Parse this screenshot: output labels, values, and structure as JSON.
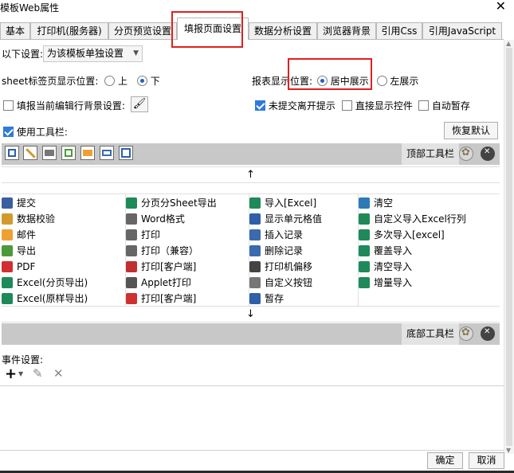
{
  "window": {
    "title": "模板Web属性",
    "close_glyph": "✕"
  },
  "tabs": [
    {
      "label": "基本"
    },
    {
      "label": "打印机(服务器)"
    },
    {
      "label": "分页预览设置"
    },
    {
      "label": "填报页面设置",
      "active": true
    },
    {
      "label": "数据分析设置"
    },
    {
      "label": "浏览器背景"
    },
    {
      "label": "引用Css"
    },
    {
      "label": "引用JavaScript"
    }
  ],
  "settings": {
    "mode_label": "以下设置:",
    "mode_value": "为该模板单独设置",
    "sheet_tab_label": "sheet标签页显示位置:",
    "sheet_tab_top": "上",
    "sheet_tab_bottom": "下",
    "report_pos_label": "报表显示位置:",
    "report_pos_center": "居中展示",
    "report_pos_left": "左展示",
    "fill_bg_label": "填报当前编辑行背景设置:",
    "unsubmitted_label": "未提交离开提示",
    "direct_show_label": "直接显示控件",
    "autosave_label": "自动暂存",
    "use_toolbar_label": "使用工具栏:",
    "restore_default": "恢复默认"
  },
  "top_toolbar": {
    "label": "顶部工具栏"
  },
  "bottom_toolbar": {
    "label": "底部工具栏"
  },
  "arrows": {
    "up": "↑",
    "down": "↓"
  },
  "buttons_grid": [
    [
      {
        "label": "提交",
        "icon": "save-icon",
        "color": "#3a5fa0"
      },
      {
        "label": "分页分Sheet导出",
        "icon": "excel-icon",
        "color": "#1e8a5a"
      },
      {
        "label": "导入[Excel]",
        "icon": "excel-icon",
        "color": "#1e8a5a"
      },
      {
        "label": "清空",
        "icon": "eraser-icon",
        "color": "#2e7ab8"
      }
    ],
    [
      {
        "label": "数据校验",
        "icon": "pencil-icon",
        "color": "#d29a2e"
      },
      {
        "label": "Word格式",
        "icon": "word-icon",
        "color": "#666666"
      },
      {
        "label": "显示单元格值",
        "icon": "cell-icon",
        "color": "#2e5fa8"
      },
      {
        "label": "自定义导入Excel行列",
        "icon": "excel-icon",
        "color": "#1e8a5a"
      }
    ],
    [
      {
        "label": "邮件",
        "icon": "mail-icon",
        "color": "#f0a030"
      },
      {
        "label": "打印",
        "icon": "print-icon",
        "color": "#666666"
      },
      {
        "label": "插入记录",
        "icon": "insert-row-icon",
        "color": "#3a6ab0"
      },
      {
        "label": "多次导入[excel]",
        "icon": "excel-icon",
        "color": "#1e8a5a"
      }
    ],
    [
      {
        "label": "导出",
        "icon": "export-icon",
        "color": "#4a9a3a"
      },
      {
        "label": "打印（兼容）",
        "icon": "print-icon",
        "color": "#666666"
      },
      {
        "label": "删除记录",
        "icon": "delete-row-icon",
        "color": "#3a6ab0"
      },
      {
        "label": "覆盖导入",
        "icon": "excel-icon",
        "color": "#1e8a5a"
      }
    ],
    [
      {
        "label": "PDF",
        "icon": "pdf-icon",
        "color": "#d03030"
      },
      {
        "label": "打印[客户端]",
        "icon": "flash-print-icon",
        "color": "#c03030"
      },
      {
        "label": "打印机偏移",
        "icon": "move-icon",
        "color": "#444444"
      },
      {
        "label": "清空导入",
        "icon": "excel-icon",
        "color": "#1e8a5a"
      }
    ],
    [
      {
        "label": "Excel(分页导出)",
        "icon": "excel-icon",
        "color": "#1e8a5a"
      },
      {
        "label": "Applet打印",
        "icon": "applet-icon",
        "color": "#555555"
      },
      {
        "label": "自定义按钮",
        "icon": "gear-icon",
        "color": "#777777"
      },
      {
        "label": "增量导入",
        "icon": "excel-icon",
        "color": "#1e8a5a"
      }
    ],
    [
      {
        "label": "Excel(原样导出)",
        "icon": "excel-icon",
        "color": "#1e8a5a"
      },
      {
        "label": "打印[客户端]",
        "icon": "pdf-print-icon",
        "color": "#d03030"
      },
      {
        "label": "暂存",
        "icon": "temp-save-icon",
        "color": "#2e5fa8"
      },
      null
    ]
  ],
  "events": {
    "label": "事件设置:",
    "add_glyph": "+",
    "edit_glyph": "✎",
    "delete_glyph": "✕"
  },
  "footer": {
    "ok": "确定",
    "cancel": "取消"
  }
}
